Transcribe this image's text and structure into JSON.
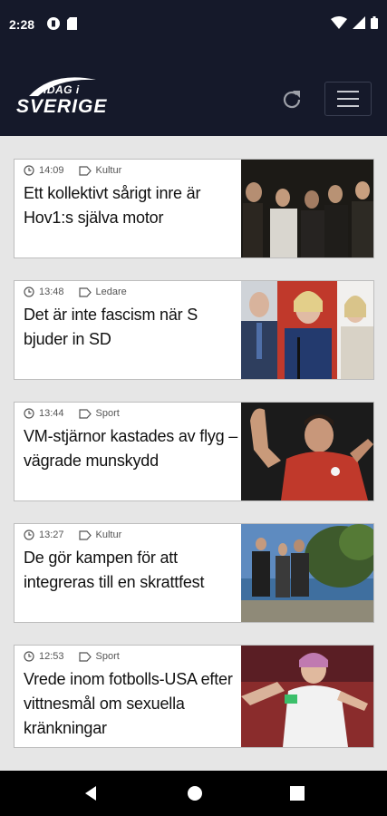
{
  "status_bar": {
    "time": "2:28"
  },
  "header": {
    "logo_small": "IDAG i",
    "logo_big": "SVERIGE"
  },
  "articles": [
    {
      "time": "14:09",
      "category": "Kultur",
      "headline": "Ett kollektivt sårigt inre är Hov1:s själva motor"
    },
    {
      "time": "13:48",
      "category": "Ledare",
      "headline": "Det är inte fascism när S bjuder in SD"
    },
    {
      "time": "13:44",
      "category": "Sport",
      "headline": "VM-stjärnor kastades av flyg – vägrade munskydd"
    },
    {
      "time": "13:27",
      "category": "Kultur",
      "headline": "De gör kampen för att integreras till en skrattfest"
    },
    {
      "time": "12:53",
      "category": "Sport",
      "headline": "Vrede inom fotbolls-USA efter vittnesmål om sexuella kränkningar"
    }
  ]
}
